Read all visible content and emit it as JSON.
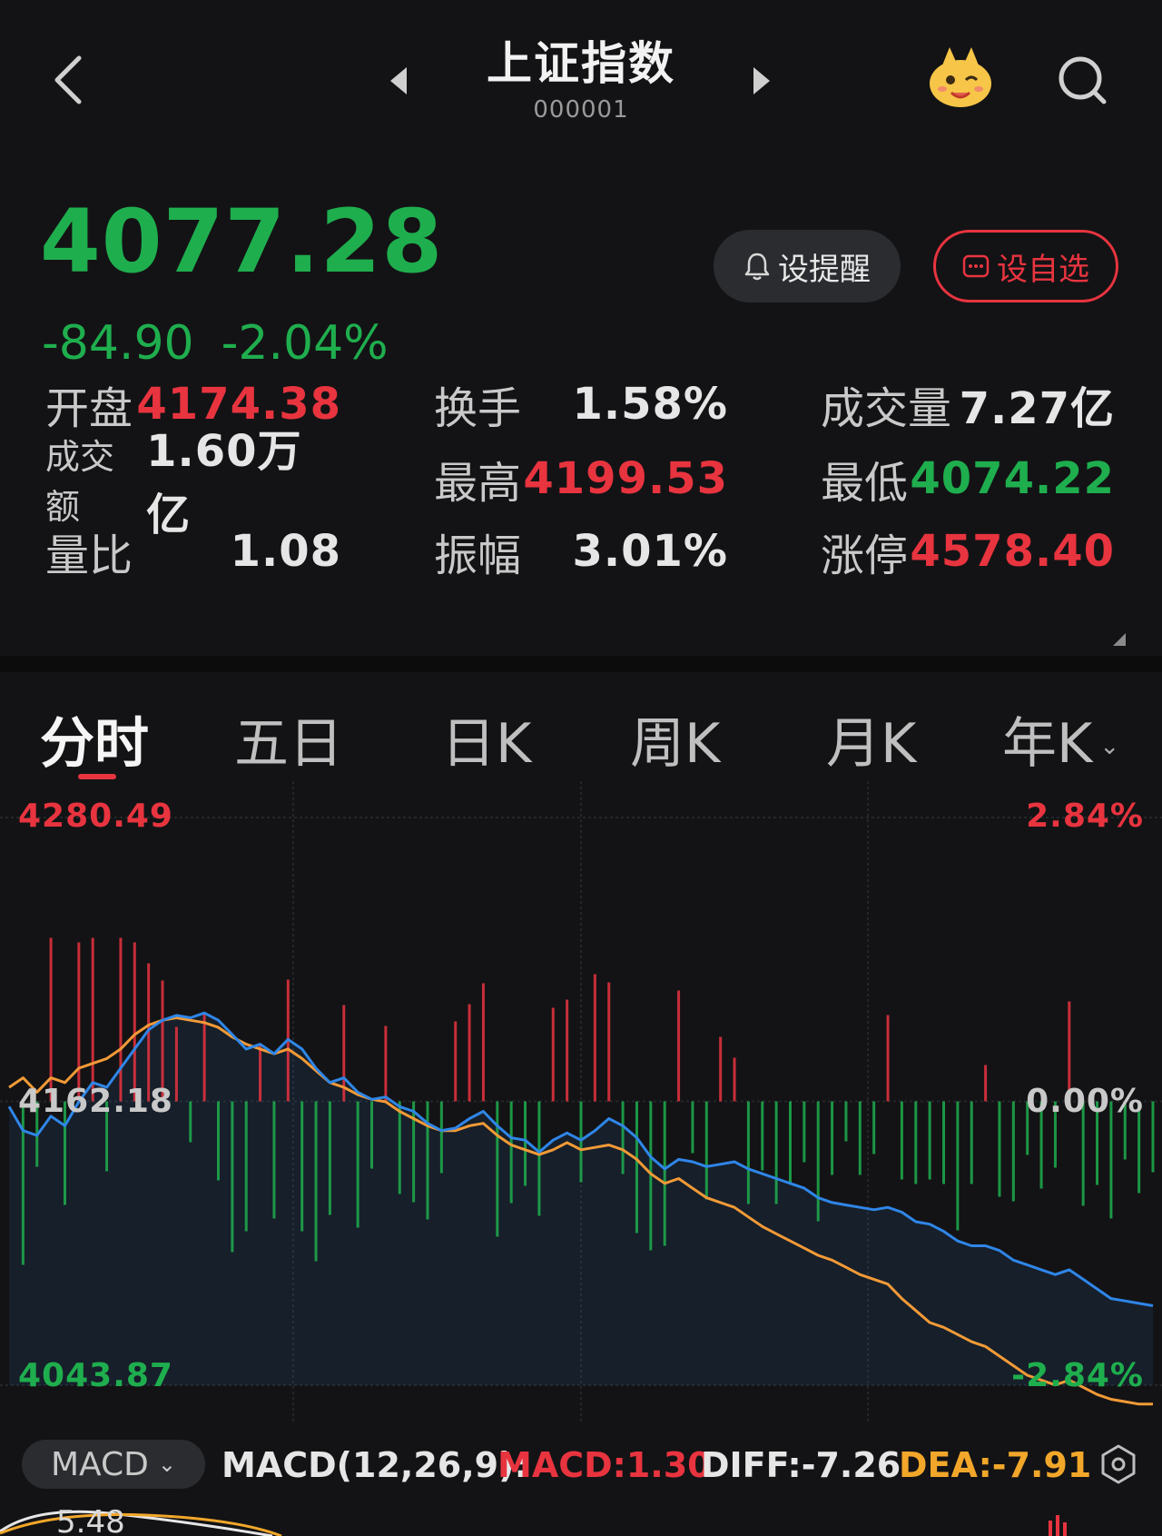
{
  "header": {
    "title": "上证指数",
    "code": "000001"
  },
  "quote": {
    "price": "4077.28",
    "change": "-84.90",
    "change_pct": "-2.04%",
    "remind_label": "设提醒",
    "fav_label": "设自选"
  },
  "stats": [
    {
      "label": "开盘",
      "value": "4174.38",
      "color": "#e8343f"
    },
    {
      "label": "换手",
      "value": "1.58%",
      "color": "#e6e6e6"
    },
    {
      "label": "成交量",
      "value": "7.27亿",
      "color": "#e6e6e6"
    },
    {
      "label": "成交额",
      "value": "1.60万亿",
      "color": "#e6e6e6"
    },
    {
      "label": "最高",
      "value": "4199.53",
      "color": "#e8343f"
    },
    {
      "label": "最低",
      "value": "4074.22",
      "color": "#1fae4e"
    },
    {
      "label": "量比",
      "value": "1.08",
      "color": "#e6e6e6"
    },
    {
      "label": "振幅",
      "value": "3.01%",
      "color": "#e6e6e6"
    },
    {
      "label": "涨停",
      "value": "4578.40",
      "color": "#e8343f"
    }
  ],
  "tabs": [
    "分时",
    "五日",
    "日K",
    "周K",
    "月K",
    "年K"
  ],
  "chart_data": {
    "type": "line",
    "y_left_labels": {
      "top": "4280.49",
      "mid": "4162.18",
      "bottom": "4043.87"
    },
    "y_right_labels": {
      "top": "2.84%",
      "mid": "0.00%",
      "bottom": "-2.84%"
    },
    "ylim": [
      4043.87,
      4280.49
    ],
    "prev_close": 4162.18,
    "series": [
      {
        "key": "price",
        "color": "#2f86e8",
        "values": [
          4160,
          4150,
          4148,
          4156,
          4152,
          4162,
          4170,
          4168,
          4176,
          4184,
          4192,
          4196,
          4198,
          4197,
          4199,
          4196,
          4190,
          4184,
          4186,
          4182,
          4188,
          4184,
          4176,
          4170,
          4172,
          4166,
          4163,
          4164,
          4160,
          4158,
          4153,
          4150,
          4151,
          4155,
          4158,
          4152,
          4147,
          4146,
          4141,
          4146,
          4149,
          4146,
          4150,
          4155,
          4152,
          4147,
          4139,
          4134,
          4138,
          4137,
          4135,
          4136,
          4137,
          4134,
          4132,
          4130,
          4128,
          4126,
          4122,
          4120,
          4119,
          4118,
          4117,
          4118,
          4116,
          4112,
          4111,
          4108,
          4104,
          4102,
          4102,
          4100,
          4096,
          4094,
          4092,
          4090,
          4092,
          4088,
          4084,
          4080,
          4079,
          4078,
          4077
        ]
      },
      {
        "key": "avg",
        "color": "#f29a37",
        "values": [
          4168,
          4172,
          4166,
          4172,
          4170,
          4176,
          4178,
          4180,
          4184,
          4190,
          4194,
          4196,
          4197,
          4196,
          4195,
          4193,
          4189,
          4186,
          4184,
          4182,
          4184,
          4180,
          4175,
          4170,
          4168,
          4165,
          4163,
          4162,
          4158,
          4155,
          4152,
          4150,
          4150,
          4152,
          4153,
          4148,
          4144,
          4142,
          4140,
          4142,
          4145,
          4142,
          4143,
          4144,
          4142,
          4138,
          4132,
          4128,
          4130,
          4126,
          4122,
          4120,
          4118,
          4114,
          4110,
          4107,
          4104,
          4101,
          4098,
          4096,
          4093,
          4090,
          4088,
          4086,
          4080,
          4075,
          4070,
          4068,
          4065,
          4062,
          4060,
          4056,
          4052,
          4048,
          4046,
          4044,
          4046,
          4043,
          4040,
          4038,
          4037,
          4036,
          4036
        ]
      }
    ]
  },
  "macd": {
    "selector": "MACD",
    "params": "MACD(12,26,9):",
    "macd": "MACD:1.30",
    "diff": "DIFF:-7.26",
    "dea": "DEA:-7.91"
  },
  "bottom_value": "5.48",
  "colors": {
    "up": "#e8343f",
    "down": "#1fae4e",
    "price_line": "#2f86e8",
    "avg_line": "#f29a37",
    "dea": "#f2a72a"
  }
}
